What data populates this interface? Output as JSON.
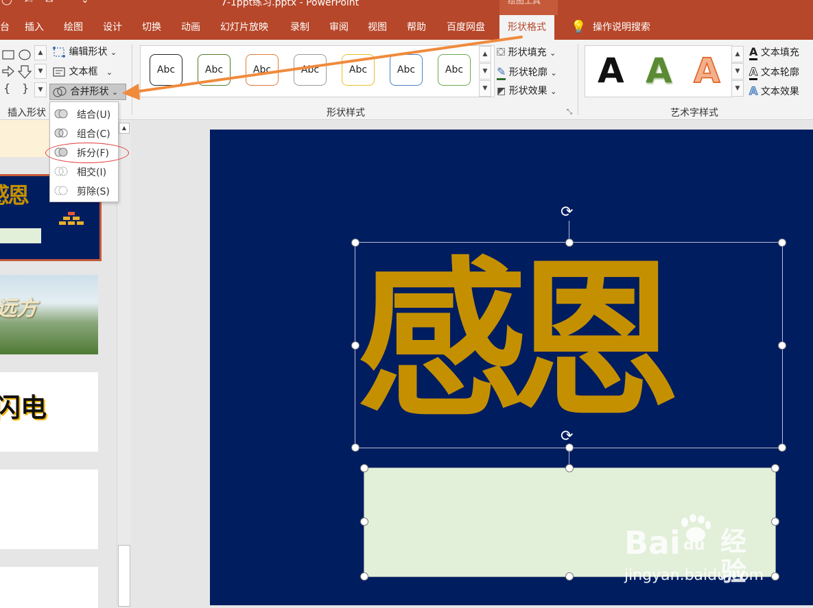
{
  "titlebar": {
    "title": "7-1ppt练习.pptx - PowerPoint",
    "context_label": "绘图工具"
  },
  "tabs": [
    {
      "label": "台",
      "active": false
    },
    {
      "label": "插入",
      "active": false
    },
    {
      "label": "绘图",
      "active": false
    },
    {
      "label": "设计",
      "active": false
    },
    {
      "label": "切换",
      "active": false
    },
    {
      "label": "动画",
      "active": false
    },
    {
      "label": "幻灯片放映",
      "active": false
    },
    {
      "label": "录制",
      "active": false
    },
    {
      "label": "审阅",
      "active": false
    },
    {
      "label": "视图",
      "active": false
    },
    {
      "label": "帮助",
      "active": false
    },
    {
      "label": "百度网盘",
      "active": false
    },
    {
      "label": "形状格式",
      "active": true
    }
  ],
  "tell_me": {
    "label": "操作说明搜索",
    "icon": "lightbulb-icon"
  },
  "ribbon": {
    "insert_shapes": {
      "group_label": "插入形状",
      "edit_shape": "编辑形状",
      "text_box": "文本框",
      "merge_shapes": "合并形状"
    },
    "shape_styles": {
      "group_label": "形状样式",
      "swatch_text": "Abc",
      "swatch_colors": [
        "#222222",
        "#4f7a28",
        "#e07a3a",
        "#9a9a9a",
        "#e6c02a",
        "#4a7ebf",
        "#6aa84f"
      ],
      "fill": "形状填充",
      "outline": "形状轮廓",
      "effects": "形状效果"
    },
    "wordart_styles": {
      "group_label": "艺术字样式",
      "letter": "A",
      "letter_colors": [
        "#111111",
        "#5a8a32",
        "#f3b08a"
      ],
      "text_fill": "文本填充",
      "text_outline": "文本轮廓",
      "text_effects": "文本效果"
    }
  },
  "merge_menu": [
    {
      "label": "结合(U)",
      "icon": "union-icon"
    },
    {
      "label": "组合(C)",
      "icon": "combine-icon"
    },
    {
      "label": "拆分(F)",
      "icon": "fragment-icon"
    },
    {
      "label": "相交(I)",
      "icon": "intersect-icon"
    },
    {
      "label": "剪除(S)",
      "icon": "subtract-icon"
    }
  ],
  "thumbnails": [
    {
      "text": "感恩",
      "type": "selected"
    },
    {
      "text": "远方",
      "type": "landscape"
    },
    {
      "text": "闪电",
      "type": "white"
    },
    {
      "text": "",
      "type": "white"
    },
    {
      "text": "",
      "type": "white"
    }
  ],
  "slide": {
    "background": "#001d60",
    "main_text": "感恩",
    "text_color": "#c59000",
    "rect_fill": "#e2efd9"
  },
  "watermark": {
    "brand": "Bai",
    "brand2": "du",
    "cn": "经验",
    "url": "jingyan.baidu.com"
  },
  "colors": {
    "accent": "#b7472a",
    "annotation_arrow": "#f08a3c",
    "annotation_circle": "#e23a3a"
  }
}
